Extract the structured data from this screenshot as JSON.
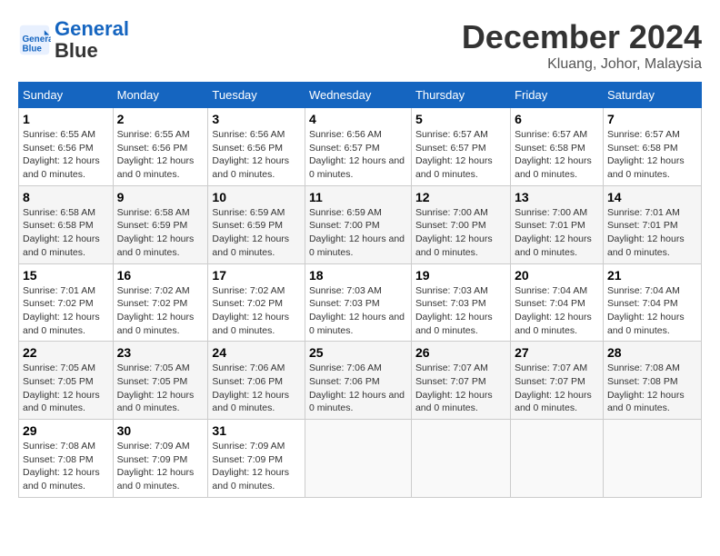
{
  "logo": {
    "line1": "General",
    "line2": "Blue"
  },
  "title": "December 2024",
  "location": "Kluang, Johor, Malaysia",
  "days_of_week": [
    "Sunday",
    "Monday",
    "Tuesday",
    "Wednesday",
    "Thursday",
    "Friday",
    "Saturday"
  ],
  "weeks": [
    [
      {
        "day": 1,
        "sunrise": "6:55 AM",
        "sunset": "6:56 PM",
        "daylight": "12 hours and 0 minutes."
      },
      {
        "day": 2,
        "sunrise": "6:55 AM",
        "sunset": "6:56 PM",
        "daylight": "12 hours and 0 minutes."
      },
      {
        "day": 3,
        "sunrise": "6:56 AM",
        "sunset": "6:56 PM",
        "daylight": "12 hours and 0 minutes."
      },
      {
        "day": 4,
        "sunrise": "6:56 AM",
        "sunset": "6:57 PM",
        "daylight": "12 hours and 0 minutes."
      },
      {
        "day": 5,
        "sunrise": "6:57 AM",
        "sunset": "6:57 PM",
        "daylight": "12 hours and 0 minutes."
      },
      {
        "day": 6,
        "sunrise": "6:57 AM",
        "sunset": "6:58 PM",
        "daylight": "12 hours and 0 minutes."
      },
      {
        "day": 7,
        "sunrise": "6:57 AM",
        "sunset": "6:58 PM",
        "daylight": "12 hours and 0 minutes."
      }
    ],
    [
      {
        "day": 8,
        "sunrise": "6:58 AM",
        "sunset": "6:58 PM",
        "daylight": "12 hours and 0 minutes."
      },
      {
        "day": 9,
        "sunrise": "6:58 AM",
        "sunset": "6:59 PM",
        "daylight": "12 hours and 0 minutes."
      },
      {
        "day": 10,
        "sunrise": "6:59 AM",
        "sunset": "6:59 PM",
        "daylight": "12 hours and 0 minutes."
      },
      {
        "day": 11,
        "sunrise": "6:59 AM",
        "sunset": "7:00 PM",
        "daylight": "12 hours and 0 minutes."
      },
      {
        "day": 12,
        "sunrise": "7:00 AM",
        "sunset": "7:00 PM",
        "daylight": "12 hours and 0 minutes."
      },
      {
        "day": 13,
        "sunrise": "7:00 AM",
        "sunset": "7:01 PM",
        "daylight": "12 hours and 0 minutes."
      },
      {
        "day": 14,
        "sunrise": "7:01 AM",
        "sunset": "7:01 PM",
        "daylight": "12 hours and 0 minutes."
      }
    ],
    [
      {
        "day": 15,
        "sunrise": "7:01 AM",
        "sunset": "7:02 PM",
        "daylight": "12 hours and 0 minutes."
      },
      {
        "day": 16,
        "sunrise": "7:02 AM",
        "sunset": "7:02 PM",
        "daylight": "12 hours and 0 minutes."
      },
      {
        "day": 17,
        "sunrise": "7:02 AM",
        "sunset": "7:02 PM",
        "daylight": "12 hours and 0 minutes."
      },
      {
        "day": 18,
        "sunrise": "7:03 AM",
        "sunset": "7:03 PM",
        "daylight": "12 hours and 0 minutes."
      },
      {
        "day": 19,
        "sunrise": "7:03 AM",
        "sunset": "7:03 PM",
        "daylight": "12 hours and 0 minutes."
      },
      {
        "day": 20,
        "sunrise": "7:04 AM",
        "sunset": "7:04 PM",
        "daylight": "12 hours and 0 minutes."
      },
      {
        "day": 21,
        "sunrise": "7:04 AM",
        "sunset": "7:04 PM",
        "daylight": "12 hours and 0 minutes."
      }
    ],
    [
      {
        "day": 22,
        "sunrise": "7:05 AM",
        "sunset": "7:05 PM",
        "daylight": "12 hours and 0 minutes."
      },
      {
        "day": 23,
        "sunrise": "7:05 AM",
        "sunset": "7:05 PM",
        "daylight": "12 hours and 0 minutes."
      },
      {
        "day": 24,
        "sunrise": "7:06 AM",
        "sunset": "7:06 PM",
        "daylight": "12 hours and 0 minutes."
      },
      {
        "day": 25,
        "sunrise": "7:06 AM",
        "sunset": "7:06 PM",
        "daylight": "12 hours and 0 minutes."
      },
      {
        "day": 26,
        "sunrise": "7:07 AM",
        "sunset": "7:07 PM",
        "daylight": "12 hours and 0 minutes."
      },
      {
        "day": 27,
        "sunrise": "7:07 AM",
        "sunset": "7:07 PM",
        "daylight": "12 hours and 0 minutes."
      },
      {
        "day": 28,
        "sunrise": "7:08 AM",
        "sunset": "7:08 PM",
        "daylight": "12 hours and 0 minutes."
      }
    ],
    [
      {
        "day": 29,
        "sunrise": "7:08 AM",
        "sunset": "7:08 PM",
        "daylight": "12 hours and 0 minutes."
      },
      {
        "day": 30,
        "sunrise": "7:09 AM",
        "sunset": "7:09 PM",
        "daylight": "12 hours and 0 minutes."
      },
      {
        "day": 31,
        "sunrise": "7:09 AM",
        "sunset": "7:09 PM",
        "daylight": "12 hours and 0 minutes."
      },
      null,
      null,
      null,
      null
    ]
  ]
}
